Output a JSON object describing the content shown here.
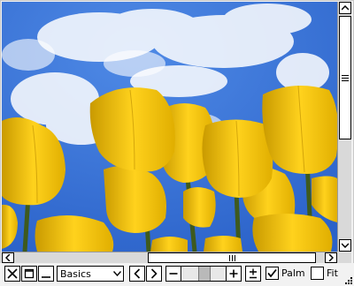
{
  "image": {
    "subject": "yellow-tulips-blue-sky"
  },
  "toolbar": {
    "mode_select_value": "Basics",
    "palm_label": "Palm",
    "palm_checked": true,
    "fit_label": "Fit",
    "fit_checked": false
  },
  "zoom": {
    "level_fraction": 0.5
  },
  "icons": {
    "close": "close-icon",
    "maximize": "maximize-icon",
    "minimize": "minimize-icon",
    "prev": "chevron-left-icon",
    "next": "chevron-right-icon",
    "zoom_out": "minus-icon",
    "zoom_in": "plus-icon",
    "zoom_reset": "plus-minus-icon",
    "dropdown": "chevron-down-icon",
    "resize": "resize-grip-icon"
  },
  "colors": {
    "sky": "#3b75d9",
    "tulip": "#f5c400",
    "stem": "#3e5a1e",
    "chrome": "#d9d9d9"
  }
}
